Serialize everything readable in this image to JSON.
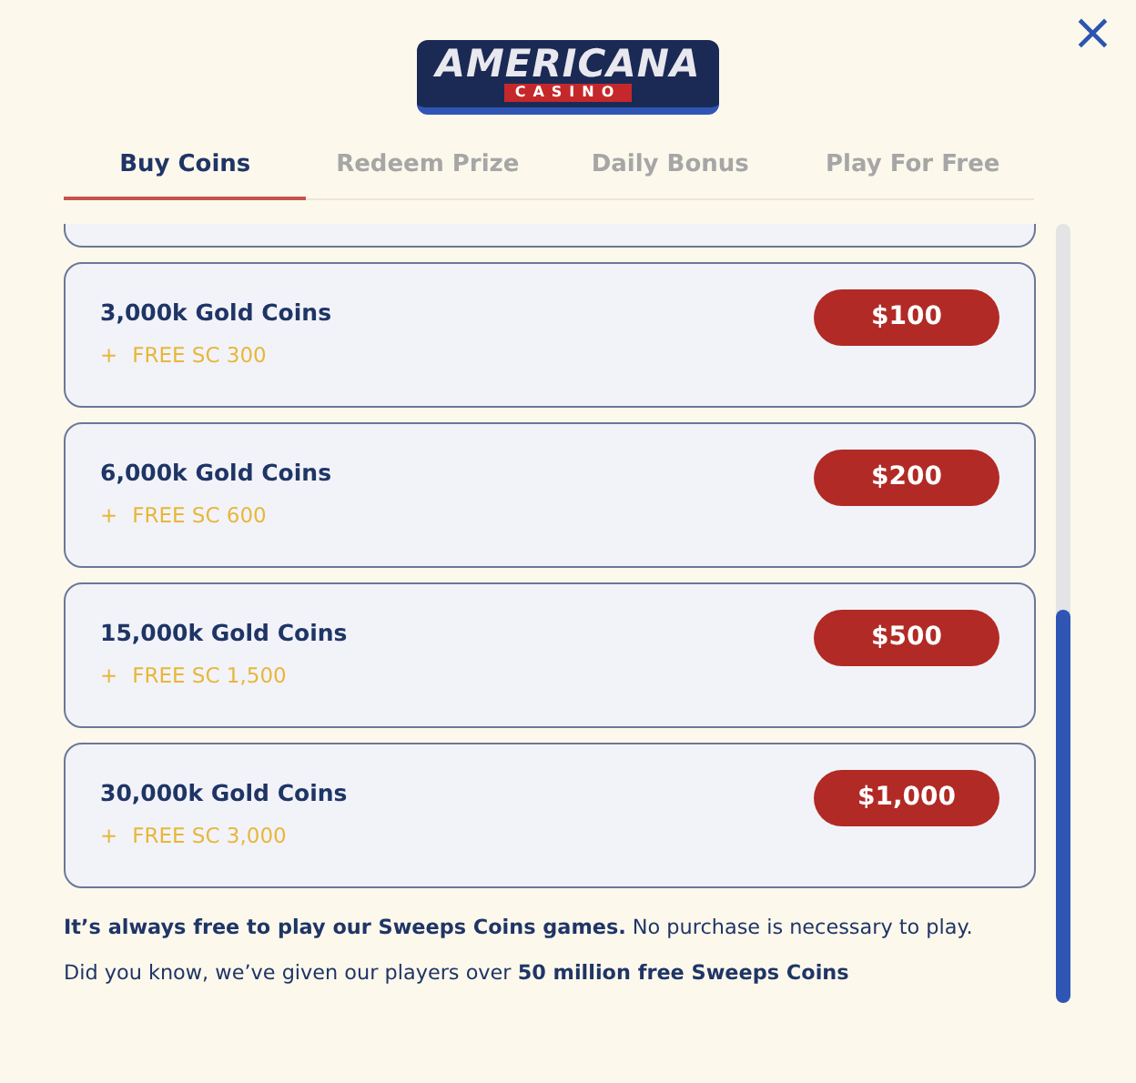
{
  "logo": {
    "title": "AMERICANA",
    "subtitle": "CASINO"
  },
  "close": "×",
  "tabs": [
    {
      "label": "Buy Coins",
      "selected": true
    },
    {
      "label": "Redeem Prize",
      "selected": false
    },
    {
      "label": "Daily Bonus",
      "selected": false
    },
    {
      "label": "Play For Free",
      "selected": false
    }
  ],
  "packages": [
    {
      "coins": "3,000k Gold Coins",
      "plus": "+",
      "bonus": "FREE SC 300",
      "price": "$100"
    },
    {
      "coins": "6,000k Gold Coins",
      "plus": "+",
      "bonus": "FREE SC 600",
      "price": "$200"
    },
    {
      "coins": "15,000k Gold Coins",
      "plus": "+",
      "bonus": "FREE SC 1,500",
      "price": "$500"
    },
    {
      "coins": "30,000k Gold Coins",
      "plus": "+",
      "bonus": "FREE SC 3,000",
      "price": "$1,000"
    }
  ],
  "notes": [
    "**It’s always free to play our Sweeps Coins games.** No purchase is necessary to play.",
    "Did you know, we’ve given our players over **50 million free Sweeps Coins**"
  ]
}
